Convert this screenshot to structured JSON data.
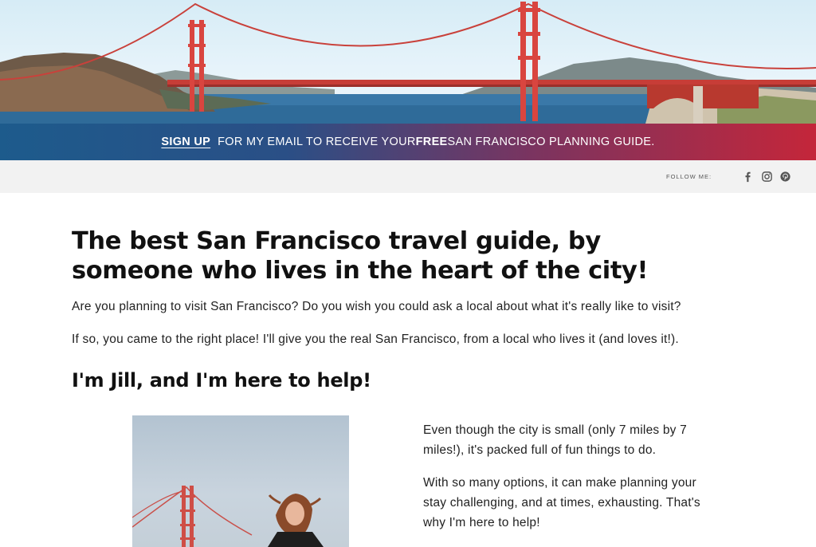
{
  "hero": {
    "image": "golden-gate-bridge-banner"
  },
  "signup": {
    "link_label": "SIGN UP",
    "text_before_free": "FOR MY EMAIL TO RECEIVE YOUR ",
    "free": "FREE",
    "text_after_free": " SAN FRANCISCO PLANNING GUIDE."
  },
  "social": {
    "follow_label": "FOLLOW ME:",
    "icons": [
      "facebook-icon",
      "instagram-icon",
      "pinterest-icon"
    ]
  },
  "main": {
    "title": "The best San Francisco travel guide, by someone who lives in the heart of the city!",
    "intro_1": "Are you planning to visit San Francisco? Do you wish you could ask a local about what it's really like to visit?",
    "intro_2": "If so, you came to the right place! I'll give you the real San Francisco, from a local who lives it (and loves it!).",
    "subheading": "I'm Jill, and I'm here to help!",
    "side_1": "Even though the city is small (only 7 miles by 7 miles!), it's packed full of fun things to do.",
    "side_2": "With so many options, it can make planning your stay challenging, and at times, exhausting. That's why I'm here to help!"
  },
  "colors": {
    "bar_start": "#1d5b8c",
    "bar_end": "#c4263a",
    "bridge": "#d9453f"
  }
}
